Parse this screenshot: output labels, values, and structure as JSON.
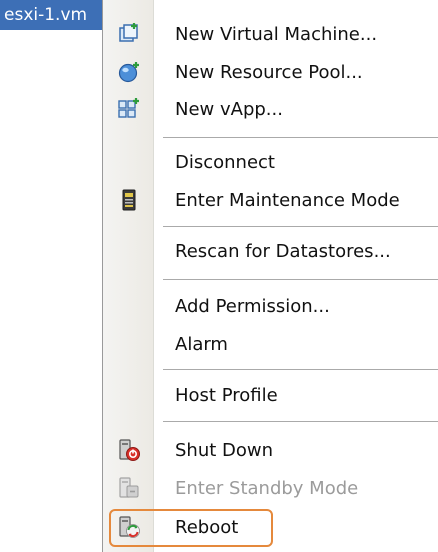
{
  "host": {
    "name": "esxi-1.vm"
  },
  "menu": {
    "items": [
      {
        "label": "New Virtual Machine...",
        "icon": "new-vm-icon",
        "enabled": true
      },
      {
        "label": "New Resource Pool...",
        "icon": "resource-pool-icon",
        "enabled": true
      },
      {
        "label": "New vApp...",
        "icon": "vapp-icon",
        "enabled": true
      },
      {
        "label": "Disconnect",
        "icon": "",
        "enabled": true
      },
      {
        "label": "Enter Maintenance Mode",
        "icon": "maintenance-icon",
        "enabled": true
      },
      {
        "label": "Rescan for Datastores...",
        "icon": "",
        "enabled": true
      },
      {
        "label": "Add Permission...",
        "icon": "",
        "enabled": true
      },
      {
        "label": "Alarm",
        "icon": "",
        "enabled": true
      },
      {
        "label": "Host Profile",
        "icon": "",
        "enabled": true
      },
      {
        "label": "Shut Down",
        "icon": "shutdown-icon",
        "enabled": true
      },
      {
        "label": "Enter Standby Mode",
        "icon": "standby-icon",
        "enabled": false
      },
      {
        "label": "Reboot",
        "icon": "reboot-icon",
        "enabled": true
      }
    ]
  },
  "colors": {
    "highlight": "#e5893c",
    "selection": "#3d6fb6"
  }
}
